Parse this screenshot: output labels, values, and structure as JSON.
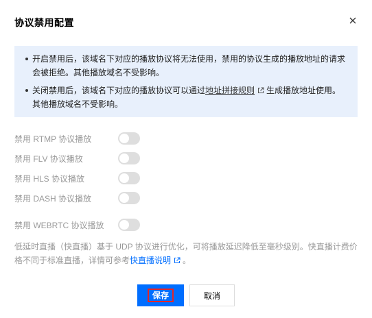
{
  "dialog": {
    "title": "协议禁用配置",
    "close_icon": "close-icon"
  },
  "notice": {
    "bullet1": "开启禁用后，该域名下对应的播放协议将无法使用，禁用的协议生成的播放地址的请求会被拒绝。其他播放域名不受影响。",
    "bullet2_before": "关闭禁用后，该域名下对应的播放协议可以通过",
    "bullet2_link": "地址拼接规则",
    "bullet2_after": "生成播放地址使用。其他播放域名不受影响。",
    "link_icon": "external-link-icon"
  },
  "protocols": [
    {
      "label": "禁用 RTMP 协议播放",
      "enabled": false
    },
    {
      "label": "禁用 FLV 协议播放",
      "enabled": false
    },
    {
      "label": "禁用 HLS 协议播放",
      "enabled": false
    },
    {
      "label": "禁用 DASH 协议播放",
      "enabled": false
    },
    {
      "label": "禁用 WEBRTC 协议播放",
      "enabled": false
    }
  ],
  "footnote": {
    "text": "低延时直播（快直播）基于 UDP 协议进行优化，可将播放延迟降低至毫秒级别。快直播计费价格不同于标准直播，详情可参考",
    "link": "快直播说明",
    "end": "。"
  },
  "buttons": {
    "save": "保存",
    "cancel": "取消"
  },
  "colors": {
    "primary": "#006eff",
    "notice_bg": "#e8f0fc",
    "toggle_off": "#dedede",
    "focus_ring": "#e3262a"
  }
}
